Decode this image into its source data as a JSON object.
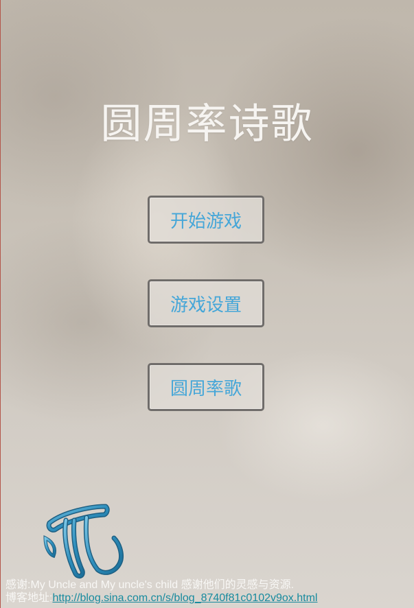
{
  "app": {
    "title": "圆周率诗歌"
  },
  "menu": {
    "start_label": "开始游戏",
    "settings_label": "游戏设置",
    "song_label": "圆周率歌"
  },
  "logo": {
    "icon": "pi-icon",
    "color": "#2f8fbd"
  },
  "footer": {
    "thanks": "感谢:My Uncle and My uncle's child 感谢他们的灵感与资源.",
    "blog_prefix": "博客地址:",
    "blog_link": "http://blog.sina.com.cn/s/blog_8740f81c0102v9ox.html"
  },
  "colors": {
    "button_text": "#45a6d8",
    "button_border": "#6f6c6a",
    "link": "#178a9e"
  }
}
